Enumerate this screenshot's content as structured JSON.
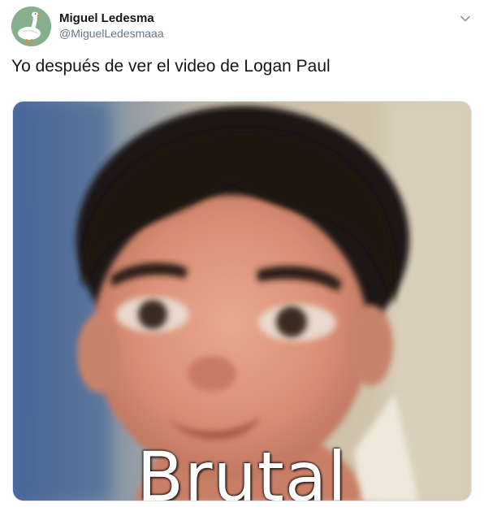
{
  "tweet": {
    "author": {
      "display_name": "Miguel Ledesma",
      "handle": "@MiguelLedesmaaa",
      "avatar": "goose-avatar"
    },
    "text": "Yo después de ver el video de Logan Paul",
    "media": {
      "caption": "Brutal",
      "subject": "doll-face-meme-image"
    },
    "more_menu_icon": "chevron-down-icon"
  },
  "colors": {
    "text_primary": "#14171a",
    "text_secondary": "#657786",
    "avatar_bg": "#86b08d",
    "border": "#e1e8ed"
  }
}
